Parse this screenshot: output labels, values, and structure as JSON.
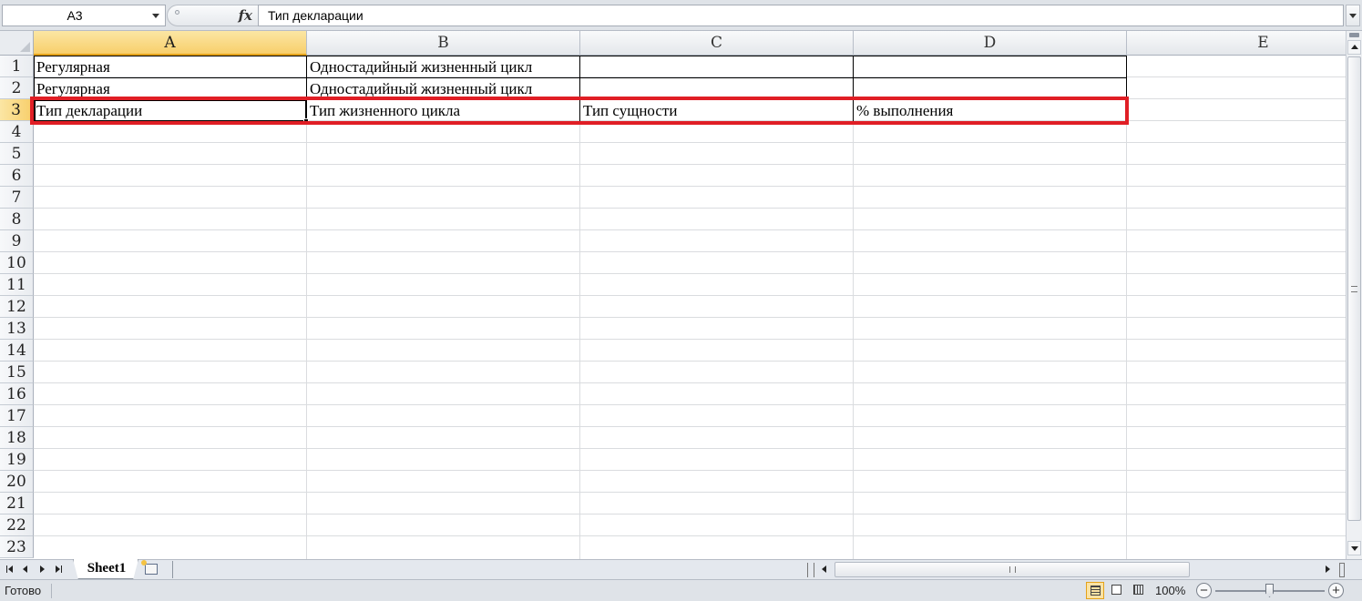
{
  "formula_bar": {
    "name_box": "A3",
    "fx_label": "fx",
    "formula": "Тип декларации"
  },
  "columns": [
    "A",
    "B",
    "C",
    "D",
    "E"
  ],
  "rows": [
    "1",
    "2",
    "3",
    "4",
    "5",
    "6",
    "7",
    "8",
    "9",
    "10",
    "11",
    "12",
    "13",
    "14",
    "15",
    "16",
    "17",
    "18",
    "19",
    "20",
    "21",
    "22",
    "23"
  ],
  "selected": {
    "column": "A",
    "row": "3"
  },
  "cells": {
    "A1": "Регулярная",
    "B1": "Одностадийный жизненный цикл",
    "A2": "Регулярная",
    "B2": "Одностадийный жизненный цикл",
    "A3": "Тип декларации",
    "B3": "Тип жизненного цикла",
    "C3": "Тип сущности",
    "D3": "% выполнения"
  },
  "highlight_color": "#e01e25",
  "sheet_tabs": [
    {
      "label": "Sheet1",
      "active": true
    }
  ],
  "status_bar": {
    "status": "Готово",
    "zoom": "100%",
    "zoom_out": "−",
    "zoom_in": "+"
  }
}
